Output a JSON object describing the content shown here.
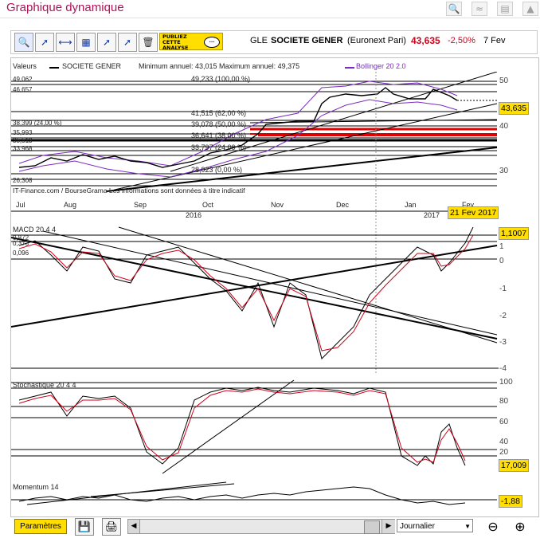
{
  "app_title": "Graphique dynamique",
  "toolbar": {
    "publiez_label_1": "PUBLIEZ",
    "publiez_label_2": "CETTE",
    "publiez_label_3": "ANALYSE",
    "ticker": "GLE",
    "company": "SOCIETE GENER",
    "market": "(Euronext Pari)",
    "price": "43,635",
    "change": "-2,50%",
    "date": "7 Fev"
  },
  "main_chart": {
    "header_values": "Valeurs",
    "series_name": "SOCIETE GENER",
    "min_max": "Minimum annuel: 43,015 Maximum annuel: 49,375",
    "bollinger": "Bollinger 20 2.0",
    "right_axis": [
      "50",
      "40",
      "30"
    ],
    "price_box": "43,635",
    "fib_levels": [
      "49,233 (100,00 %)",
      "41,515 (62,00 %)",
      "39,078 (50,00 %)",
      "36,641 (38,00 %)",
      "33,797 (24,00 %)",
      "28,923 (0,00 %)"
    ],
    "left_levels": [
      "49,062",
      "46,657",
      "38,399 (24,00 %)",
      "35,993",
      "35,513",
      "33,968",
      "26,308"
    ],
    "source": "IT-Finance.com / BourseGrama Les informations sont données à titre indicatif",
    "months": [
      "Jul",
      "Aug",
      "Sep",
      "Oct",
      "Nov",
      "Dec",
      "Jan",
      "Fev"
    ],
    "years": [
      "2016",
      "2017"
    ],
    "cursor_date": "21 Fev 2017"
  },
  "macd": {
    "title": "MACD 20 4 4",
    "left_values": [
      "0,872",
      "0,373",
      "0,096"
    ],
    "right_axis": [
      "1",
      "0",
      "-1",
      "-2",
      "-3",
      "-4"
    ],
    "value_box": "1,1007"
  },
  "stoch": {
    "title": "Stochastique 20 4 4",
    "right_axis": [
      "100",
      "80",
      "60",
      "40",
      "20"
    ],
    "value_box": "17,009"
  },
  "momentum": {
    "title": "Momentum 14",
    "value_box": "-1,88"
  },
  "bottom": {
    "param_label": "Paramètres",
    "period": "Journalier"
  }
}
